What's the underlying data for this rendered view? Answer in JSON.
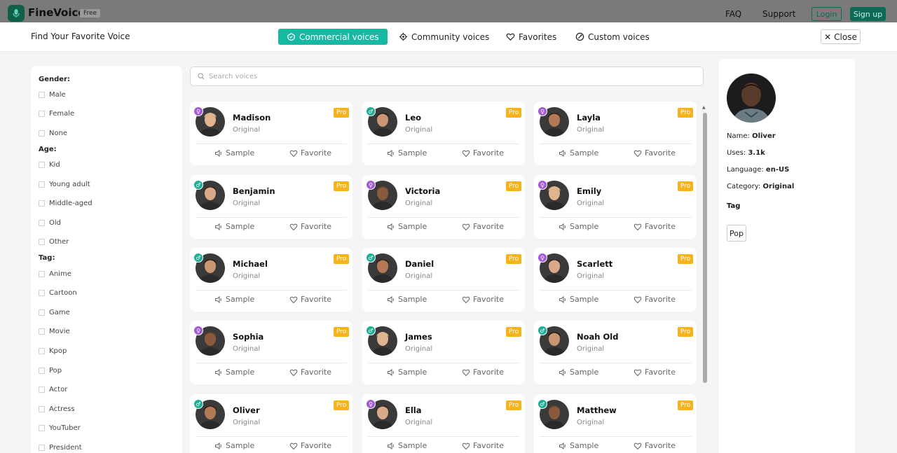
{
  "app": {
    "brand": "FineVoice",
    "plan_badge": "Free",
    "nav": {
      "faq": "FAQ",
      "support": "Support",
      "login": "Login",
      "signup": "Sign up"
    }
  },
  "modal": {
    "title": "Find Your Favorite Voice",
    "tabs": [
      {
        "label": "Commercial voices",
        "icon": "commercial-voice-icon",
        "active": true
      },
      {
        "label": "Community voices",
        "icon": "community-gear-icon",
        "active": false
      },
      {
        "label": "Favorites",
        "icon": "heart-icon",
        "active": false
      },
      {
        "label": "Custom voices",
        "icon": "custom-voice-icon",
        "active": false
      }
    ],
    "close_label": "Close"
  },
  "filters": {
    "gender": {
      "title": "Gender:",
      "options": [
        "Male",
        "Female",
        "None"
      ]
    },
    "age": {
      "title": "Age:",
      "options": [
        "Kid",
        "Young adult",
        "Middle-aged",
        "Old",
        "Other"
      ]
    },
    "tag": {
      "title": "Tag:",
      "options": [
        "Anime",
        "Cartoon",
        "Game",
        "Movie",
        "Kpop",
        "Pop",
        "Actor",
        "Actress",
        "YouTuber",
        "President"
      ]
    }
  },
  "search": {
    "placeholder": "Search voices",
    "value": ""
  },
  "card_labels": {
    "sample": "Sample",
    "favorite": "Favorite",
    "pro": "Pro"
  },
  "voices": [
    {
      "name": "Madison",
      "category": "Original",
      "gender": "female"
    },
    {
      "name": "Leo",
      "category": "Original",
      "gender": "male"
    },
    {
      "name": "Layla",
      "category": "Original",
      "gender": "female"
    },
    {
      "name": "Benjamin",
      "category": "Original",
      "gender": "male"
    },
    {
      "name": "Victoria",
      "category": "Original",
      "gender": "female"
    },
    {
      "name": "Emily",
      "category": "Original",
      "gender": "female"
    },
    {
      "name": "Michael",
      "category": "Original",
      "gender": "male"
    },
    {
      "name": "Daniel",
      "category": "Original",
      "gender": "male"
    },
    {
      "name": "Scarlett",
      "category": "Original",
      "gender": "female"
    },
    {
      "name": "Sophia",
      "category": "Original",
      "gender": "female"
    },
    {
      "name": "James",
      "category": "Original",
      "gender": "male"
    },
    {
      "name": "Noah Old",
      "category": "Original",
      "gender": "male"
    },
    {
      "name": "Oliver",
      "category": "Original",
      "gender": "male"
    },
    {
      "name": "Ella",
      "category": "Original",
      "gender": "female"
    },
    {
      "name": "Matthew",
      "category": "Original",
      "gender": "male"
    }
  ],
  "selected": {
    "name_label": "Name:",
    "name": "Oliver",
    "uses_label": "Uses:",
    "uses": "3.1k",
    "language_label": "Language:",
    "language": "en-US",
    "category_label": "Category:",
    "category": "Original",
    "tag_heading": "Tag",
    "tags": [
      "Pop"
    ]
  },
  "colors": {
    "accent": "#18b9a3",
    "brand_dark": "#0c6a55",
    "pro": "#f7b31b",
    "female": "#a35cd6",
    "male": "#1fae95"
  }
}
